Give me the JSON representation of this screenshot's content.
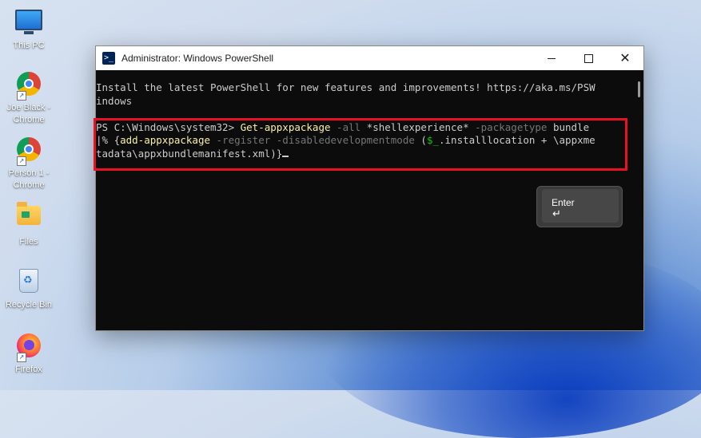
{
  "desktop": {
    "icons": [
      {
        "label": "This PC"
      },
      {
        "label": "Joe Black - Chrome"
      },
      {
        "label": "Person 1 - Chrome"
      },
      {
        "label": "Files"
      },
      {
        "label": "Recycle Bin"
      },
      {
        "label": "Firefox"
      }
    ]
  },
  "window": {
    "title": "Administrator: Windows PowerShell",
    "controls": {
      "minimize": "minimize",
      "maximize": "maximize",
      "close": "✕"
    }
  },
  "console": {
    "banner_line1": "Install the latest PowerShell for new features and improvements! https://aka.ms/PSW",
    "banner_line2": "indows",
    "prompt": "PS C:\\Windows\\system32> ",
    "cmd_l1": {
      "t1": "Get-appxpackage",
      "t2": " -all ",
      "t3": "*shellexperience*",
      "t4": " -packagetype ",
      "t5": "bundle"
    },
    "cmd_l2": {
      "t1": "|% {",
      "t2": "add-appxpackage",
      "t3": " -register -disabledevelopmentmode ",
      "t4": "(",
      "t5": "$_",
      "t6": ".installlocation + \\appxme"
    },
    "cmd_l3": "tadata\\appxbundlemanifest.xml)}"
  },
  "overlay": {
    "key_label": "Enter",
    "key_arrow": "↵",
    "highlight_color": "#e81123"
  }
}
